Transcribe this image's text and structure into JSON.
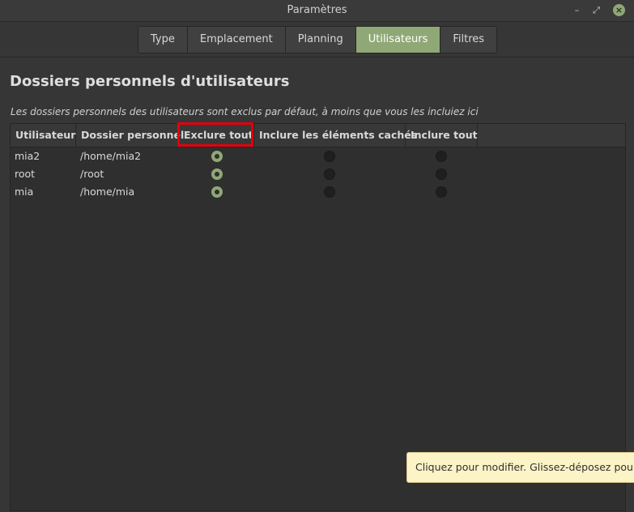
{
  "window": {
    "title": "Paramètres",
    "minimize_glyph": "–",
    "maximize_glyph": "⤢",
    "close_glyph": "×"
  },
  "tabs": [
    {
      "label": "Type",
      "active": false
    },
    {
      "label": "Emplacement",
      "active": false
    },
    {
      "label": "Planning",
      "active": false
    },
    {
      "label": "Utilisateurs",
      "active": true
    },
    {
      "label": "Filtres",
      "active": false
    }
  ],
  "page": {
    "heading": "Dossiers personnels d'utilisateurs",
    "subtitle": "Les dossiers personnels des utilisateurs sont exclus par défaut, à moins que vous les incluiez ici"
  },
  "table": {
    "columns": [
      "Utilisateur",
      "Dossier personnel",
      "Exclure tout",
      "Inclure les éléments cachés",
      "Inclure tout"
    ],
    "highlighted_column": "Exclure tout",
    "rows": [
      {
        "user": "mia2",
        "home": "/home/mia2",
        "selected": "Exclure tout"
      },
      {
        "user": "root",
        "home": "/root",
        "selected": "Exclure tout"
      },
      {
        "user": "mia",
        "home": "/home/mia",
        "selected": "Exclure tout"
      }
    ]
  },
  "tooltip": {
    "text": "Cliquez pour modifier. Glissez-déposez pour r"
  },
  "colors": {
    "accent": "#8fa876",
    "highlight_box": "#e2000d",
    "tooltip_bg": "#fcf3c6"
  }
}
